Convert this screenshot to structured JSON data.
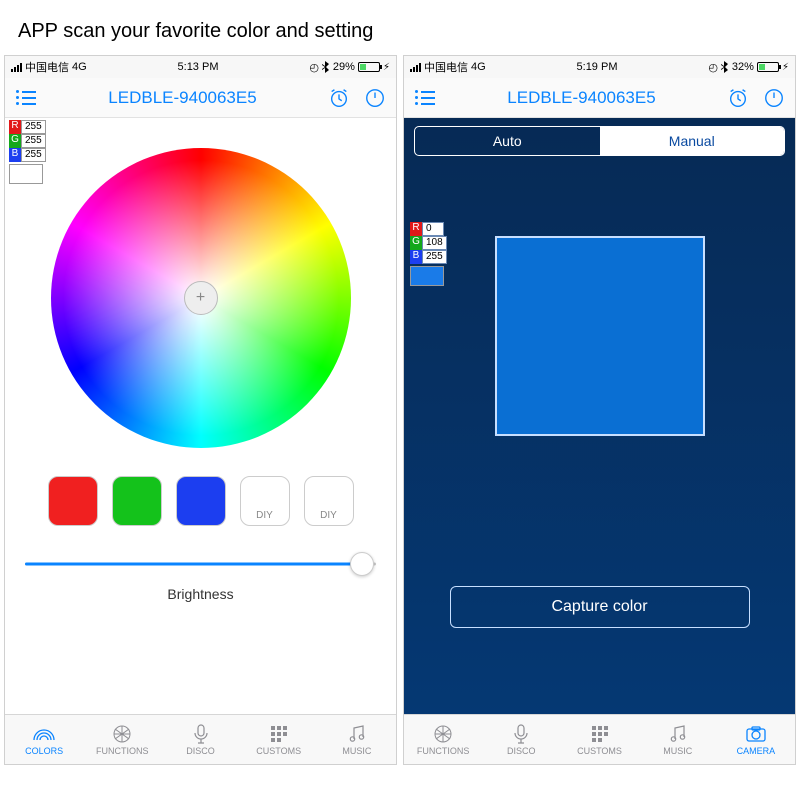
{
  "page_title": "APP scan your favorite color and setting",
  "left": {
    "status": {
      "carrier": "中国电信",
      "network": "4G",
      "time": "5:13 PM",
      "battery_pct": "29%",
      "battery_fill_pct": 29
    },
    "device_title": "LEDBLE-940063E5",
    "rgb": {
      "r_label": "R",
      "r_val": "255",
      "g_label": "G",
      "g_val": "255",
      "b_label": "B",
      "b_val": "255",
      "swatch_color": "#ffffff"
    },
    "presets": {
      "red": "#f02020",
      "green": "#14c21b",
      "blue": "#1c3ef0",
      "diy1": "DIY",
      "diy2": "DIY"
    },
    "brightness_label": "Brightness",
    "brightness_value_pct": 96,
    "tabs": {
      "colors": "COLORS",
      "functions": "FUNCTIONS",
      "disco": "DISCO",
      "customs": "CUSTOMS",
      "music": "MUSIC"
    }
  },
  "right": {
    "status": {
      "carrier": "中国电信",
      "network": "4G",
      "time": "5:19 PM",
      "battery_pct": "32%",
      "battery_fill_pct": 32
    },
    "device_title": "LEDBLE-940063E5",
    "segmented": {
      "auto": "Auto",
      "manual": "Manual"
    },
    "rgb": {
      "r_label": "R",
      "r_val": "0",
      "g_label": "G",
      "g_val": "108",
      "b_label": "B",
      "b_val": "255",
      "swatch_color": "#1a7be8"
    },
    "capture_label": "Capture color",
    "tabs": {
      "functions": "FUNCTIONS",
      "disco": "DISCO",
      "customs": "CUSTOMS",
      "music": "MUSIC",
      "camera": "CAMERA"
    }
  },
  "colors": {
    "rgb_r_bg": "#e11919",
    "rgb_g_bg": "#14a81b",
    "rgb_b_bg": "#1c3ef0",
    "accent": "#0a84ff"
  }
}
